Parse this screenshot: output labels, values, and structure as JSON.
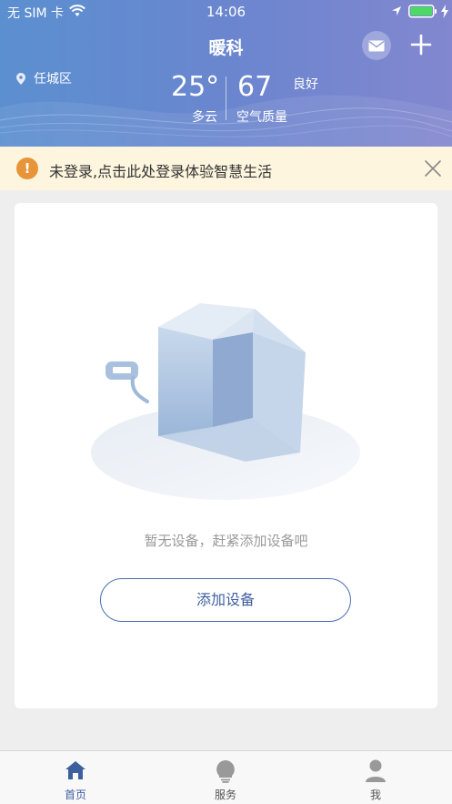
{
  "status_bar": {
    "carrier": "无 SIM 卡",
    "time": "14:06"
  },
  "header": {
    "title": "暖科",
    "city": "任城区",
    "temperature": "25°",
    "weather": "多云",
    "aqi_value": "67",
    "aqi_level": "良好",
    "aqi_label": "空气质量",
    "icons": [
      "mail-icon",
      "plus-icon",
      "location-pin-icon"
    ]
  },
  "login_banner": {
    "text": "未登录,点击此处登录体验智慧生活",
    "warn_glyph": "!"
  },
  "empty_state": {
    "message": "暂无设备，赶紧添加设备吧",
    "add_button": "添加设备"
  },
  "tabbar": {
    "items": [
      {
        "label": "首页",
        "icon": "home-icon",
        "active": true
      },
      {
        "label": "服务",
        "icon": "lightbulb-icon",
        "active": false
      },
      {
        "label": "我",
        "icon": "user-icon",
        "active": false
      }
    ]
  },
  "colors": {
    "header_start": "#5b8fd0",
    "header_end": "#8287cf",
    "accent": "#3e5f9e",
    "warning": "#e8953a",
    "banner_bg": "#fdf5de"
  }
}
